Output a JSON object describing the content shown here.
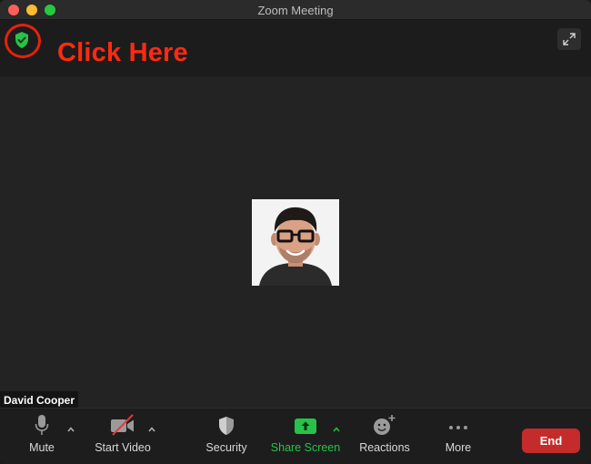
{
  "window": {
    "title": "Zoom Meeting"
  },
  "header": {
    "callout": "Click Here"
  },
  "participant": {
    "name": "David Cooper"
  },
  "toolbar": {
    "mute": "Mute",
    "start_video": "Start Video",
    "security": "Security",
    "share_screen": "Share Screen",
    "reactions": "Reactions",
    "more": "More",
    "end": "End"
  },
  "colors": {
    "accent_green": "#26c34a",
    "end_red": "#c42b2b",
    "callout_red": "#ff2a12"
  },
  "icons": [
    "shield-check-icon",
    "fullscreen-icon",
    "microphone-icon",
    "video-off-icon",
    "security-shield-icon",
    "share-screen-icon",
    "reactions-icon",
    "more-icon",
    "caret-up-icon"
  ]
}
